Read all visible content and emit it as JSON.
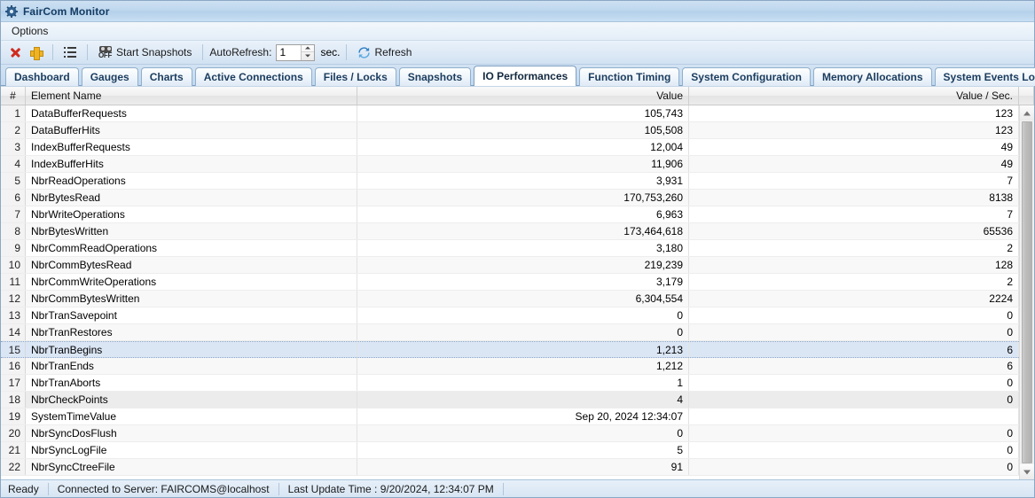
{
  "window": {
    "title": "FairCom Monitor",
    "icon": "gear-icon"
  },
  "menu": {
    "items": [
      {
        "label": "Options"
      }
    ]
  },
  "toolbar": {
    "delete_icon": "red-x-icon",
    "add_icon": "yellow-plus-icon",
    "list_icon": "list-icon",
    "snapshot_icon": "camera-off-icon",
    "start_snapshots_label": "Start Snapshots",
    "autorefresh_label": "AutoRefresh:",
    "autorefresh_value": "1",
    "autorefresh_placeholder": "1",
    "sec_label": "sec.",
    "refresh_icon": "refresh-icon",
    "refresh_label": "Refresh"
  },
  "tabs": [
    {
      "label": "Dashboard",
      "active": false
    },
    {
      "label": "Gauges",
      "active": false
    },
    {
      "label": "Charts",
      "active": false
    },
    {
      "label": "Active Connections",
      "active": false
    },
    {
      "label": "Files / Locks",
      "active": false
    },
    {
      "label": "Snapshots",
      "active": false
    },
    {
      "label": "IO Performances",
      "active": true
    },
    {
      "label": "Function Timing",
      "active": false
    },
    {
      "label": "System Configuration",
      "active": false
    },
    {
      "label": "Memory Allocations",
      "active": false
    },
    {
      "label": "System Events Log",
      "active": false
    }
  ],
  "grid": {
    "columns": [
      {
        "key": "num",
        "label": "#",
        "align": "center"
      },
      {
        "key": "name",
        "label": "Element Name",
        "align": "left"
      },
      {
        "key": "value",
        "label": "Value",
        "align": "right"
      },
      {
        "key": "vps",
        "label": "Value / Sec.",
        "align": "right"
      }
    ],
    "rows": [
      {
        "num": "1",
        "name": "DataBufferRequests",
        "value": "105,743",
        "vps": "123",
        "state": "normal"
      },
      {
        "num": "2",
        "name": "DataBufferHits",
        "value": "105,508",
        "vps": "123",
        "state": "alt"
      },
      {
        "num": "3",
        "name": "IndexBufferRequests",
        "value": "12,004",
        "vps": "49",
        "state": "normal"
      },
      {
        "num": "4",
        "name": "IndexBufferHits",
        "value": "11,906",
        "vps": "49",
        "state": "alt"
      },
      {
        "num": "5",
        "name": "NbrReadOperations",
        "value": "3,931",
        "vps": "7",
        "state": "normal"
      },
      {
        "num": "6",
        "name": "NbrBytesRead",
        "value": "170,753,260",
        "vps": "8138",
        "state": "alt"
      },
      {
        "num": "7",
        "name": "NbrWriteOperations",
        "value": "6,963",
        "vps": "7",
        "state": "normal"
      },
      {
        "num": "8",
        "name": "NbrBytesWritten",
        "value": "173,464,618",
        "vps": "65536",
        "state": "alt"
      },
      {
        "num": "9",
        "name": "NbrCommReadOperations",
        "value": "3,180",
        "vps": "2",
        "state": "normal"
      },
      {
        "num": "10",
        "name": "NbrCommBytesRead",
        "value": "219,239",
        "vps": "128",
        "state": "alt"
      },
      {
        "num": "11",
        "name": "NbrCommWriteOperations",
        "value": "3,179",
        "vps": "2",
        "state": "normal"
      },
      {
        "num": "12",
        "name": "NbrCommBytesWritten",
        "value": "6,304,554",
        "vps": "2224",
        "state": "alt"
      },
      {
        "num": "13",
        "name": "NbrTranSavepoint",
        "value": "0",
        "vps": "0",
        "state": "normal"
      },
      {
        "num": "14",
        "name": "NbrTranRestores",
        "value": "0",
        "vps": "0",
        "state": "alt"
      },
      {
        "num": "15",
        "name": "NbrTranBegins",
        "value": "1,213",
        "vps": "6",
        "state": "selected"
      },
      {
        "num": "16",
        "name": "NbrTranEnds",
        "value": "1,212",
        "vps": "6",
        "state": "alt"
      },
      {
        "num": "17",
        "name": "NbrTranAborts",
        "value": "1",
        "vps": "0",
        "state": "normal"
      },
      {
        "num": "18",
        "name": "NbrCheckPoints",
        "value": "4",
        "vps": "0",
        "state": "hover"
      },
      {
        "num": "19",
        "name": "SystemTimeValue",
        "value": "Sep 20, 2024 12:34:07",
        "vps": "",
        "state": "normal"
      },
      {
        "num": "20",
        "name": "NbrSyncDosFlush",
        "value": "0",
        "vps": "0",
        "state": "alt"
      },
      {
        "num": "21",
        "name": "NbrSyncLogFile",
        "value": "5",
        "vps": "0",
        "state": "normal"
      },
      {
        "num": "22",
        "name": "NbrSyncCtreeFile",
        "value": "91",
        "vps": "0",
        "state": "alt"
      }
    ]
  },
  "scrollbar": {
    "up_icon": "arrow-up-icon",
    "down_icon": "arrow-down-icon"
  },
  "statusbar": {
    "ready": "Ready",
    "connection": "Connected to Server: FAIRCOMS@localhost",
    "last_update": "Last Update Time : 9/20/2024, 12:34:07 PM"
  },
  "colors": {
    "accent": "#1b3c5e",
    "selection": "#dbe6f5",
    "delete_icon": "#d02b1e",
    "add_icon": "#f0b323"
  }
}
